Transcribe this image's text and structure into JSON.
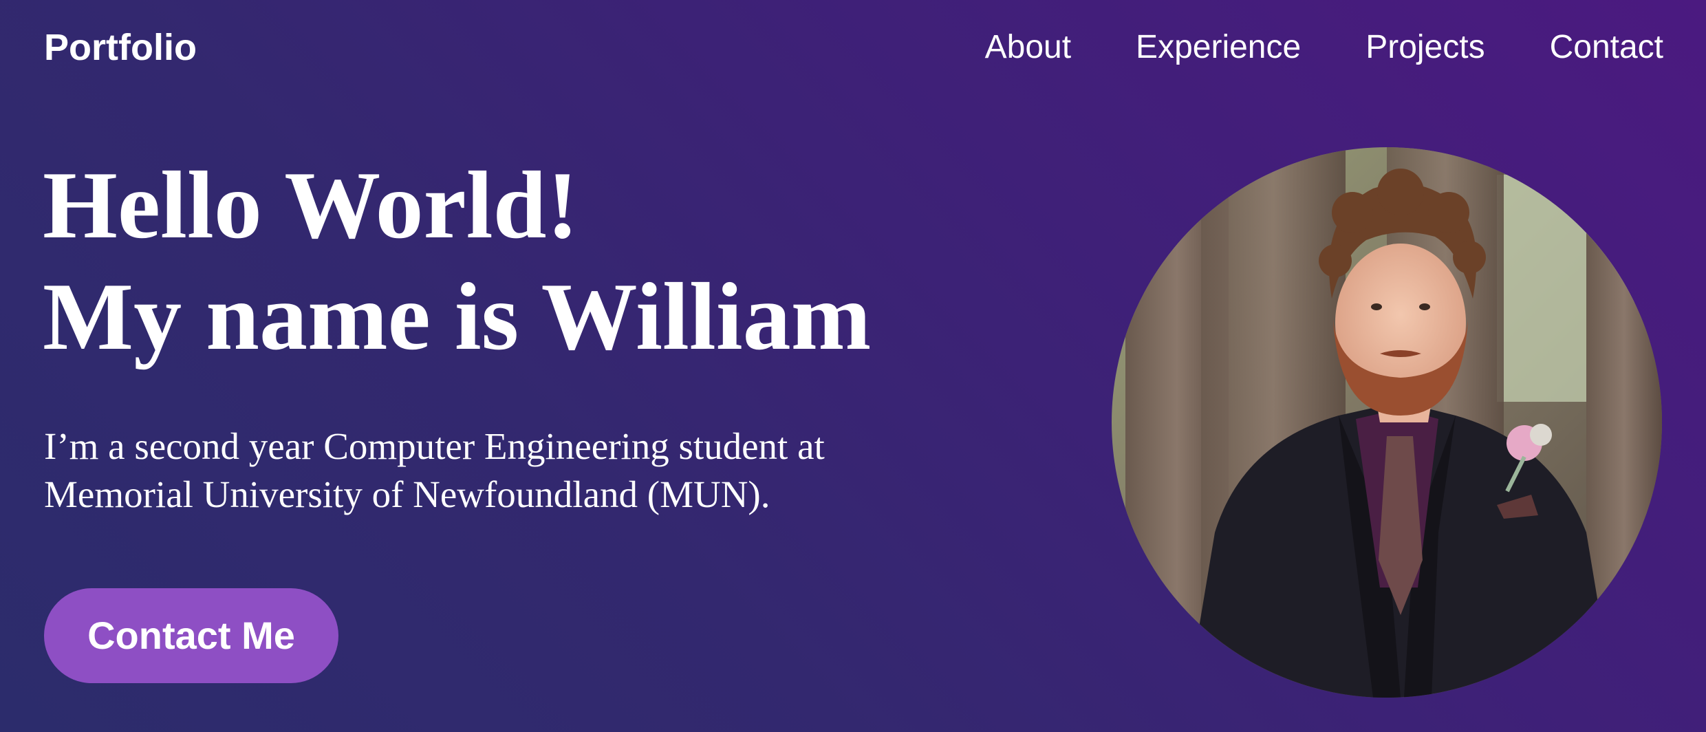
{
  "nav": {
    "brand": "Portfolio",
    "links": [
      "About",
      "Experience",
      "Projects",
      "Contact"
    ]
  },
  "hero": {
    "title_line1": "Hello World!",
    "title_line2": "My name is William",
    "description": "I’m a second year Computer Engineering student at Memorial University of Newfoundland (MUN).",
    "cta_label": "Contact Me"
  },
  "colors": {
    "bg_start": "#2c2c6c",
    "bg_end": "#4b1a80",
    "accent": "#8e4fc4",
    "text": "#ffffff"
  }
}
